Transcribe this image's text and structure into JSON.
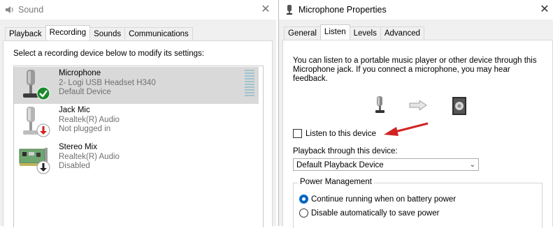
{
  "sound_window": {
    "title": "Sound",
    "close_glyph": "✕",
    "tabs": [
      {
        "label": "Playback",
        "active": false
      },
      {
        "label": "Recording",
        "active": true
      },
      {
        "label": "Sounds",
        "active": false
      },
      {
        "label": "Communications",
        "active": false
      }
    ],
    "instruction": "Select a recording device below to modify its settings:",
    "devices": [
      {
        "name": "Microphone",
        "line1": "2- Logi USB Headset H340",
        "line2": "Default Device",
        "icon": "microphone-icon",
        "status_icon": "default-check-icon",
        "selected": true
      },
      {
        "name": "Jack Mic",
        "line1": "Realtek(R) Audio",
        "line2": "Not plugged in",
        "icon": "microphone-icon",
        "status_icon": "unplugged-down-arrow-icon",
        "selected": false
      },
      {
        "name": "Stereo Mix",
        "line1": "Realtek(R) Audio",
        "line2": "Disabled",
        "icon": "sound-card-icon",
        "status_icon": "disabled-down-arrow-icon",
        "selected": false
      }
    ]
  },
  "props_window": {
    "title": "Microphone Properties",
    "close_glyph": "✕",
    "tabs": [
      {
        "label": "General",
        "active": false
      },
      {
        "label": "Listen",
        "active": true
      },
      {
        "label": "Levels",
        "active": false
      },
      {
        "label": "Advanced",
        "active": false
      }
    ],
    "description": "You can listen to a portable music player or other device through this Microphone jack.  If you connect a microphone, you may hear feedback.",
    "listen_checkbox": {
      "label": "Listen to this device",
      "checked": false
    },
    "playback_label": "Playback through this device:",
    "playback_select": {
      "value": "Default Playback Device"
    },
    "power_management": {
      "legend": "Power Management",
      "options": [
        {
          "label": "Continue running when on battery power",
          "checked": true
        },
        {
          "label": "Disable automatically to save power",
          "checked": false
        }
      ]
    }
  },
  "colors": {
    "accent": "#0067c0",
    "annotation_arrow": "#d32222",
    "check_green": "#1a8a2c",
    "down_red": "#d42020"
  }
}
